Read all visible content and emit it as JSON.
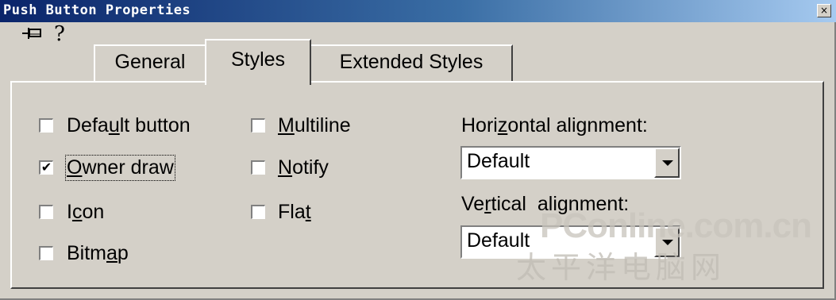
{
  "window": {
    "title": "Push Button Properties",
    "close_glyph": "×"
  },
  "toolbar": {
    "pin_icon": "pushpin-icon",
    "help_glyph": "?"
  },
  "tabs": [
    {
      "label": "General",
      "active": false
    },
    {
      "label": "Styles",
      "active": true
    },
    {
      "label": "Extended Styles",
      "active": false
    }
  ],
  "checkboxes": {
    "default_button": {
      "pre": "Defa",
      "mnemonic": "u",
      "post": "lt button",
      "checked": false
    },
    "owner_draw": {
      "pre": "",
      "mnemonic": "O",
      "post": "wner draw",
      "checked": true
    },
    "icon": {
      "pre": "I",
      "mnemonic": "c",
      "post": "on",
      "checked": false
    },
    "bitmap": {
      "pre": "Bitm",
      "mnemonic": "a",
      "post": "p",
      "checked": false
    },
    "multiline": {
      "pre": "",
      "mnemonic": "M",
      "post": "ultiline",
      "checked": false
    },
    "notify": {
      "pre": "",
      "mnemonic": "N",
      "post": "otify",
      "checked": false
    },
    "flat": {
      "pre": "Fla",
      "mnemonic": "t",
      "post": "",
      "checked": false
    }
  },
  "check_glyph": "✔",
  "horizontal_alignment": {
    "label_pre": "Hori",
    "label_mnemonic": "z",
    "label_post": "ontal alignment:",
    "value": "Default"
  },
  "vertical_alignment": {
    "label_pre": "Ve",
    "label_mnemonic": "r",
    "label_post": "tical  alignment:",
    "value": "Default"
  },
  "watermark": {
    "line1": "PConline.com.cn",
    "line2": "太平洋电脑网"
  }
}
